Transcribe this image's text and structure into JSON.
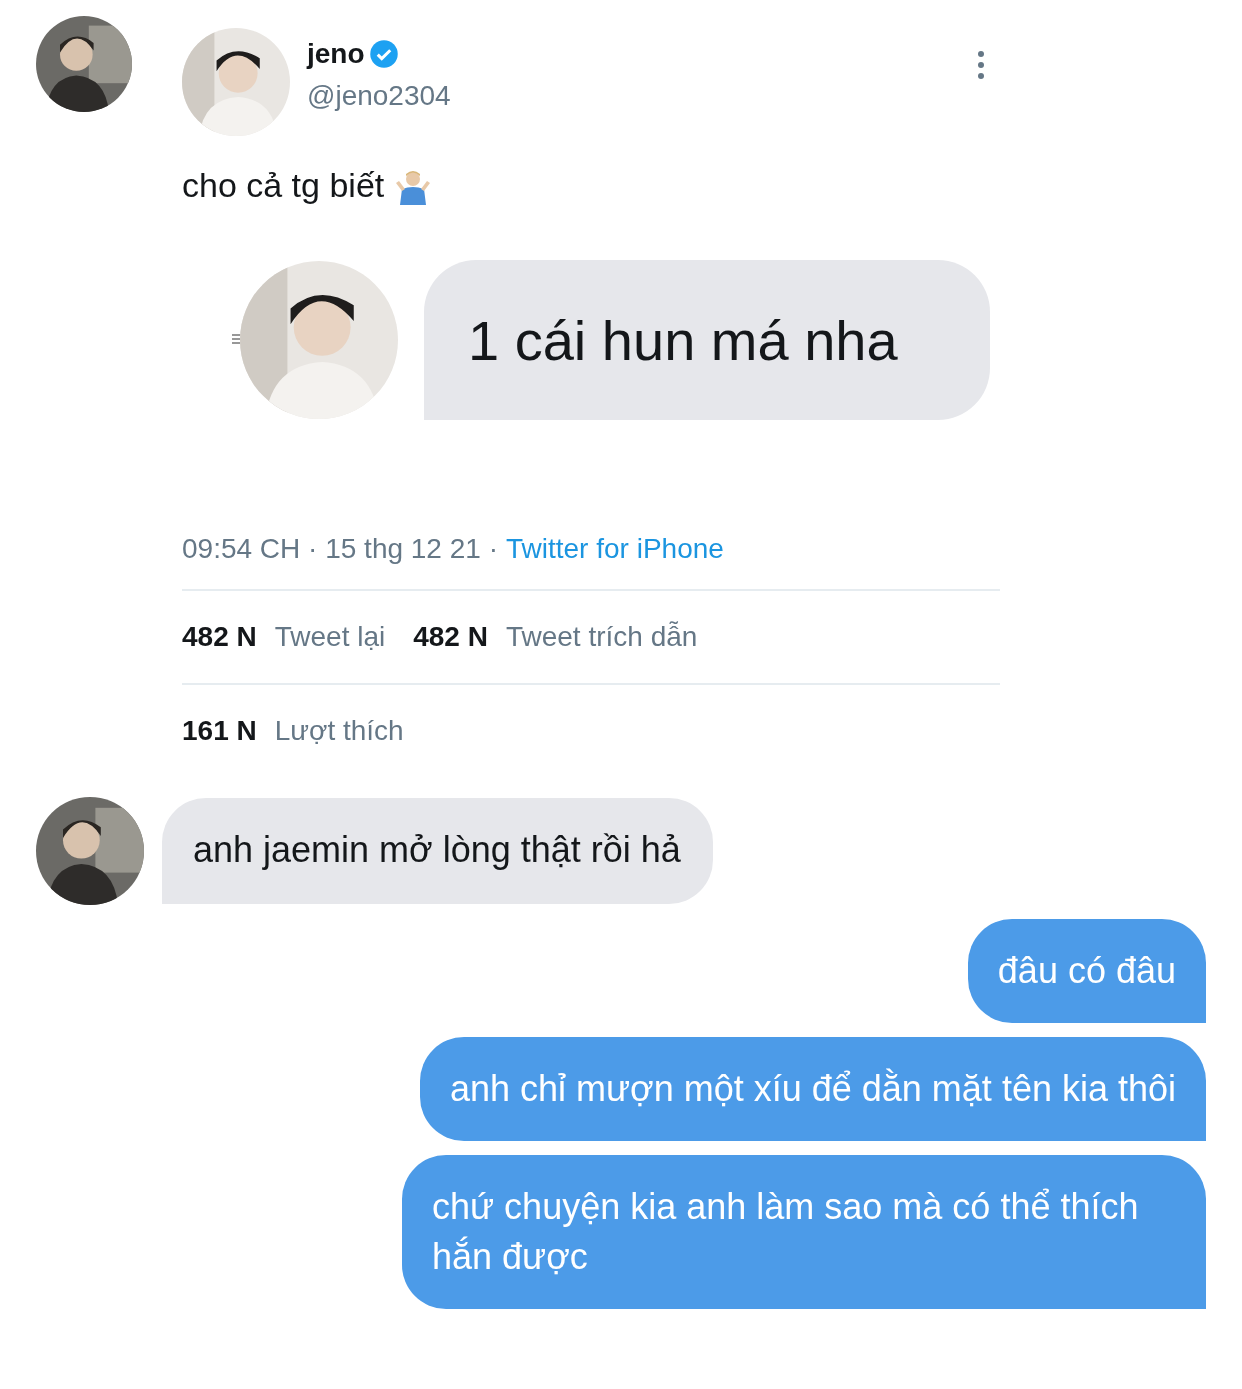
{
  "tweet": {
    "author": {
      "name": "jeno",
      "verified": true,
      "handle": "@jeno2304"
    },
    "text": "cho cả tg biết",
    "media": {
      "message": "1 cái hun má nha"
    },
    "timestamp": "09:54 CH · 15 thg 12 21 ·",
    "source": "Twitter for iPhone",
    "stats": [
      {
        "count": "482 N",
        "label": "Tweet lại"
      },
      {
        "count": "482 N",
        "label": "Tweet trích dẫn"
      }
    ],
    "likes": {
      "count": "161 N",
      "label": "Lượt thích"
    }
  },
  "messages": [
    {
      "kind": "received",
      "text": "anh jaemin mở lòng thật rồi hả"
    },
    {
      "kind": "sent",
      "text": "đâu có đâu"
    },
    {
      "kind": "sent",
      "text": "anh chỉ mượn một xíu để dằn mặt tên kia thôi"
    },
    {
      "kind": "sent",
      "text": "chứ chuyện kia anh làm sao mà có thể thích hắn được"
    }
  ]
}
